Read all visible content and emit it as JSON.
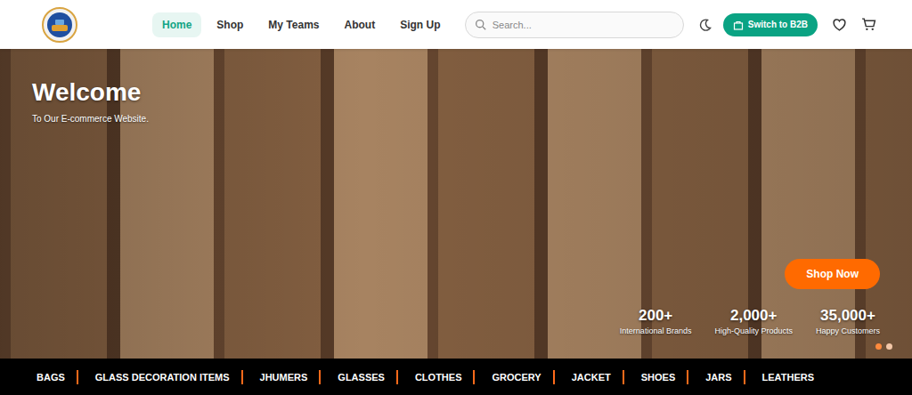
{
  "header": {
    "nav": [
      {
        "label": "Home",
        "selected": true
      },
      {
        "label": "Shop",
        "selected": false
      },
      {
        "label": "My Teams",
        "selected": false
      },
      {
        "label": "About",
        "selected": false
      },
      {
        "label": "Sign Up",
        "selected": false
      }
    ],
    "search": {
      "placeholder": "Search..."
    },
    "b2b_button": "Switch to B2B"
  },
  "hero": {
    "title": "Welcome",
    "subtitle": "To Our E-commerce Website.",
    "button": "Shop Now",
    "stats": [
      {
        "value": "200+",
        "label": "International Brands"
      },
      {
        "value": "2,000+",
        "label": "High-Quality Products"
      },
      {
        "value": "35,000+",
        "label": "Happy Customers"
      }
    ],
    "slides": [
      {
        "selected": true
      },
      {
        "selected": false
      }
    ]
  },
  "categories": [
    "BAGS",
    "GLASS DECORATION ITEMS",
    "JHUMERS",
    "GLASSES",
    "CLOTHES",
    "GROCERY",
    "JACKET",
    "SHOES",
    "JARS",
    "LEATHERS"
  ]
}
